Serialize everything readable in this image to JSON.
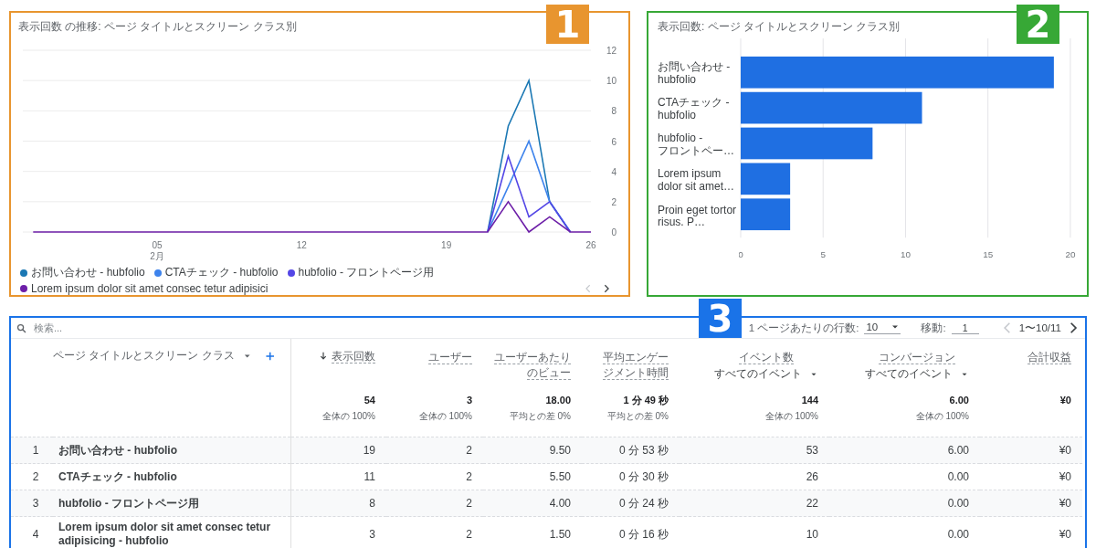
{
  "callouts": [
    {
      "label": "1",
      "color": "#e8952f"
    },
    {
      "label": "2",
      "color": "#37a836"
    },
    {
      "label": "3",
      "color": "#1a73e8"
    }
  ],
  "line_panel": {
    "title": "表示回数 の推移: ページ タイトルとスクリーン クラス別",
    "month_label": "2月",
    "legend_nav": {
      "prev_enabled": false,
      "next_enabled": true
    },
    "chart_data": {
      "type": "line",
      "x": [
        -1,
        0,
        1,
        2,
        3,
        4,
        5,
        6,
        7,
        8,
        9,
        10,
        11,
        12,
        13,
        14,
        15,
        16,
        17,
        18,
        19,
        20,
        21,
        22,
        23,
        24,
        25,
        26
      ],
      "xlim": [
        -1.5,
        26
      ],
      "ylim": [
        0,
        12
      ],
      "xticks": [
        {
          "value": 5,
          "label": "05"
        },
        {
          "value": 12,
          "label": "12"
        },
        {
          "value": 19,
          "label": "19"
        },
        {
          "value": 26,
          "label": "26"
        }
      ],
      "yticks": [
        0,
        2,
        4,
        6,
        8,
        10,
        12
      ],
      "grid": true,
      "series": [
        {
          "name": "お問い合わせ - hubfolio",
          "color": "#1b78b4",
          "values": [
            null,
            null,
            null,
            null,
            null,
            null,
            null,
            null,
            null,
            null,
            null,
            null,
            null,
            null,
            null,
            null,
            null,
            null,
            null,
            null,
            null,
            null,
            0,
            7,
            10,
            2,
            0,
            null
          ]
        },
        {
          "name": "CTAチェック - hubfolio",
          "color": "#3d83ec",
          "values": [
            null,
            null,
            null,
            null,
            null,
            null,
            null,
            null,
            null,
            null,
            null,
            null,
            null,
            null,
            null,
            null,
            null,
            null,
            null,
            null,
            null,
            null,
            0,
            3,
            6,
            2,
            0,
            null
          ]
        },
        {
          "name": "hubfolio - フロントページ用",
          "color": "#5447e6",
          "values": [
            null,
            null,
            null,
            null,
            null,
            null,
            null,
            null,
            null,
            null,
            null,
            null,
            null,
            null,
            null,
            null,
            null,
            null,
            null,
            null,
            null,
            null,
            0,
            5,
            1,
            2,
            0,
            null
          ]
        },
        {
          "name": "Lorem ipsum dolor sit amet consec tetur adipisici",
          "color": "#6d1fa8",
          "values": [
            0,
            0,
            0,
            0,
            0,
            0,
            0,
            0,
            0,
            0,
            0,
            0,
            0,
            0,
            0,
            0,
            0,
            0,
            0,
            0,
            0,
            0,
            0,
            2,
            0,
            1,
            0,
            0
          ]
        }
      ]
    }
  },
  "bar_panel": {
    "title": "表示回数: ページ タイトルとスクリーン クラス別",
    "chart_data": {
      "type": "bar",
      "orientation": "horizontal",
      "categories": [
        "お問い合わせ - hubfolio",
        "CTAチェック - hubfolio",
        "hubfolio - フロントペー…",
        "Lorem ipsum dolor sit amet…",
        "Proin eget tortor risus. P…"
      ],
      "xlim": [
        0,
        20
      ],
      "xticks": [
        0,
        5,
        10,
        15,
        20
      ],
      "grid": true,
      "values": [
        19,
        11,
        8,
        3,
        3
      ]
    }
  },
  "table": {
    "search": {
      "placeholder": "検索..."
    },
    "pagination": {
      "rows_label": "1 ページあたりの行数:",
      "rows_value": "10",
      "goto_label": "移動:",
      "goto_value": "1",
      "range": "1〜10/11",
      "prev_enabled": false,
      "next_enabled": true
    },
    "dimension": {
      "label": "ページ タイトルとスクリーン クラス"
    },
    "columns": [
      {
        "label": "表示回数",
        "sorted": true
      },
      {
        "label": "ユーザー",
        "sorted": false
      },
      {
        "label": "ユーザーあたりのビュー",
        "sorted": false
      },
      {
        "label": "平均エンゲージメント時間",
        "sorted": false
      },
      {
        "label": "イベント数",
        "sorted": false,
        "filter": "すべてのイベント"
      },
      {
        "label": "コンバージョン",
        "sorted": false,
        "filter": "すべてのイベント"
      },
      {
        "label": "合計収益",
        "sorted": false
      }
    ],
    "totals": [
      {
        "value": "54",
        "note": "全体の 100%"
      },
      {
        "value": "3",
        "note": "全体の 100%"
      },
      {
        "value": "18.00",
        "note": "平均との差 0%"
      },
      {
        "value": "1 分 49 秒",
        "note": "平均との差 0%"
      },
      {
        "value": "144",
        "note": "全体の 100%"
      },
      {
        "value": "6.00",
        "note": "全体の 100%"
      },
      {
        "value": "¥0"
      }
    ],
    "rows": [
      {
        "index": "1",
        "name": "お問い合わせ - hubfolio",
        "cells": [
          "19",
          "2",
          "9.50",
          "0 分 53 秒",
          "53",
          "6.00",
          "¥0"
        ]
      },
      {
        "index": "2",
        "name": "CTAチェック - hubfolio",
        "cells": [
          "11",
          "2",
          "5.50",
          "0 分 30 秒",
          "26",
          "0.00",
          "¥0"
        ]
      },
      {
        "index": "3",
        "name": "hubfolio - フロントページ用",
        "cells": [
          "8",
          "2",
          "4.00",
          "0 分 24 秒",
          "22",
          "0.00",
          "¥0"
        ]
      },
      {
        "index": "4",
        "name": "Lorem ipsum dolor sit amet consec tetur adipisicing - hubfolio",
        "cells": [
          "3",
          "2",
          "1.50",
          "0 分 16 秒",
          "10",
          "0.00",
          "¥0"
        ]
      }
    ]
  }
}
